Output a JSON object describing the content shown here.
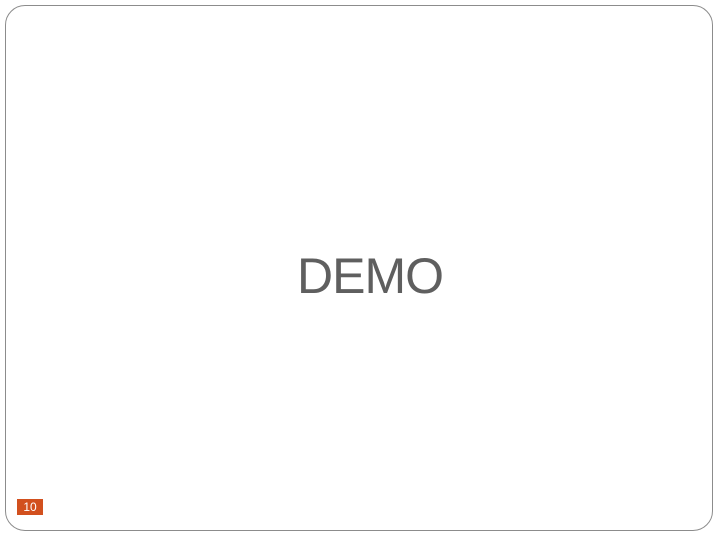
{
  "slide": {
    "title": "DEMO",
    "number": "10"
  },
  "colors": {
    "background": "#ffffff",
    "frame": "#8c8c8c",
    "title_text": "#5f5f5f",
    "number_badge": "#d2501e",
    "number_text": "#ffffff"
  }
}
